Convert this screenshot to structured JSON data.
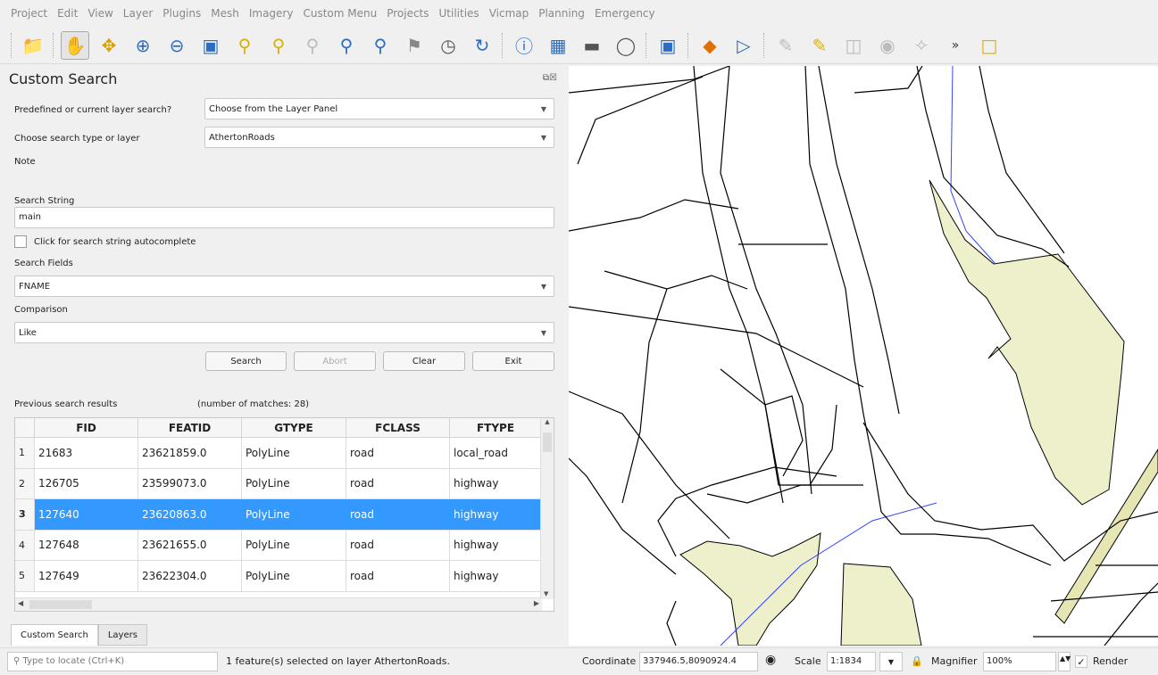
{
  "menu": [
    "Project",
    "Edit",
    "View",
    "Layer",
    "Plugins",
    "Mesh",
    "Imagery",
    "Custom Menu",
    "Projects",
    "Utilities",
    "Vicmap",
    "Planning",
    "Emergency"
  ],
  "toolbar_icons": [
    "open-project-icon",
    "pan-icon",
    "pan-to-selection-icon",
    "zoom-in-icon",
    "zoom-out-icon",
    "zoom-full-icon",
    "zoom-to-selection-icon",
    "zoom-to-layer-icon",
    "zoom-native-icon",
    "zoom-last-icon",
    "zoom-next-icon",
    "new-bookmark-icon",
    "temporal-controller-icon",
    "refresh-icon",
    "identify-icon",
    "attribute-table-icon",
    "measure-icon",
    "annotation-icon",
    "map-tips-icon",
    "add-layer-icon",
    "custom-search-icon",
    "digitize-icon",
    "edit-icon",
    "save-edits-icon",
    "add-feature-icon",
    "vertex-tool-icon",
    "select-features-icon"
  ],
  "panel": {
    "title": "Custom Search",
    "predefined_label": "Predefined or current layer search?",
    "predefined_value": "Choose from the Layer Panel",
    "search_type_label": "Choose search type or layer",
    "search_type_value": "AthertonRoads",
    "note_label": "Note",
    "search_string_label": "Search String",
    "search_string_value": "main",
    "autocomplete_label": "Click for search string autocomplete",
    "search_fields_label": "Search Fields",
    "search_fields_value": "FNAME",
    "comparison_label": "Comparison",
    "comparison_value": "Like",
    "buttons": {
      "search": "Search",
      "abort": "Abort",
      "clear": "Clear",
      "exit": "Exit"
    },
    "results_label": "Previous search results",
    "matches_label": "(number of matches: 28)"
  },
  "table": {
    "columns": [
      "FID",
      "FEATID",
      "GTYPE",
      "FCLASS",
      "FTYPE"
    ],
    "rows": [
      {
        "idx": "1",
        "fid": "21683",
        "featid": "23621859.0",
        "gtype": "PolyLine",
        "fclass": "road",
        "ftype": "local_road"
      },
      {
        "idx": "2",
        "fid": "126705",
        "featid": "23599073.0",
        "gtype": "PolyLine",
        "fclass": "road",
        "ftype": "highway"
      },
      {
        "idx": "3",
        "fid": "127640",
        "featid": "23620863.0",
        "gtype": "PolyLine",
        "fclass": "road",
        "ftype": "highway"
      },
      {
        "idx": "4",
        "fid": "127648",
        "featid": "23621655.0",
        "gtype": "PolyLine",
        "fclass": "road",
        "ftype": "highway"
      },
      {
        "idx": "5",
        "fid": "127649",
        "featid": "23622304.0",
        "gtype": "PolyLine",
        "fclass": "road",
        "ftype": "highway"
      }
    ],
    "selected_row": "3"
  },
  "tabs": [
    "Custom Search",
    "Layers"
  ],
  "status": {
    "locate_placeholder": "Type to locate (Ctrl+K)",
    "message": "1 feature(s) selected on layer AthertonRoads.",
    "coordinate_label": "Coordinate",
    "coordinate_value": "337946.5,8090924.4",
    "scale_label": "Scale",
    "scale_value": "1:1834",
    "magnifier_label": "Magnifier",
    "magnifier_value": "100%",
    "render_label": "Render"
  },
  "colors": {
    "selection": "#3399ff",
    "park_fill": "#eef0cc",
    "road_line": "#000000",
    "water_line": "#3344ff"
  }
}
